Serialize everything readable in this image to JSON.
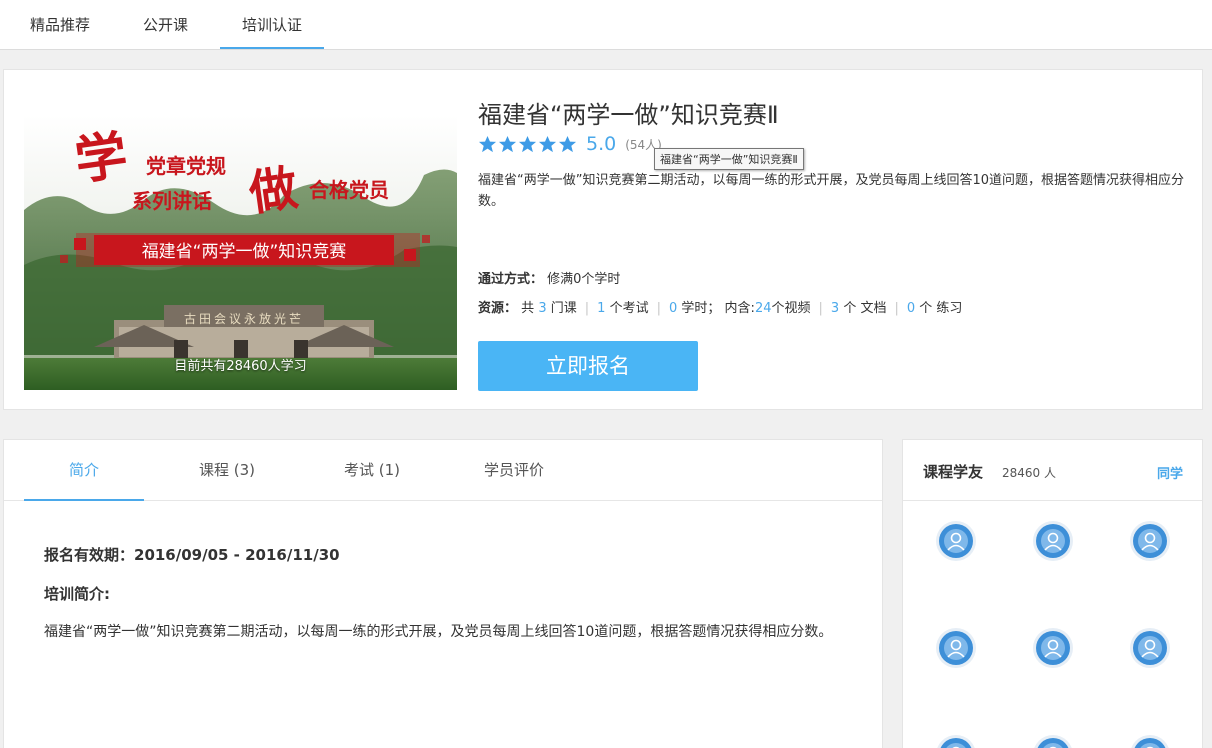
{
  "nav": {
    "tabs": [
      {
        "label": "精品推荐"
      },
      {
        "label": "公开课"
      },
      {
        "label": "培训认证"
      }
    ],
    "active_index": 2
  },
  "course": {
    "title": "福建省“两学一做”知识竞赛Ⅱ",
    "rating": 5.0,
    "score_text": "5.0",
    "rating_count": "(54人)",
    "tooltip": "福建省“两学一做”知识竞赛Ⅱ",
    "description": "福建省“两学一做”知识竞赛第二期活动，以每周一练的形式开展，及党员每周上线回答10道问题，根据答题情况获得相应分数。",
    "pass_label": "通过方式：",
    "pass_value": "修满0个学时",
    "resources": {
      "label": "资源：",
      "total_prefix": "共",
      "courses": "3",
      "courses_unit": "门课",
      "exams": "1",
      "exams_unit": "个考试",
      "hours": "0",
      "hours_unit": "学时；",
      "contains_label": "内含:",
      "videos": "24",
      "videos_unit": "个视频",
      "docs": "3",
      "docs_unit": "个 文档",
      "practice": "0",
      "practice_unit": "个 练习"
    },
    "enroll_label": "立即报名",
    "cover": {
      "line_party_rules": "党章党规",
      "line_series": "系列讲话",
      "big_char_study": "学",
      "big_char_do": "做",
      "line_qualified": "合格党员",
      "banner": "福建省“两学一做”知识竞赛",
      "sign": "古田会议永放光芒",
      "learners": "目前共有28460人学习"
    }
  },
  "detail": {
    "tabs": [
      {
        "label": "简介"
      },
      {
        "label": "课程 (3)"
      },
      {
        "label": "考试 (1)"
      },
      {
        "label": "学员评价"
      }
    ],
    "active_index": 0,
    "validity": "报名有效期：2016/09/05 - 2016/11/30",
    "intro_heading": "培训简介:",
    "intro_text": "福建省“两学一做”知识竞赛第二期活动，以每周一练的形式开展，及党员每周上线回答10道问题，根据答题情况获得相应分数。"
  },
  "classmates": {
    "title": "课程学友",
    "count": "28460 人",
    "link": "同学",
    "avatar_icon": "default-user-avatar-icon"
  },
  "colors": {
    "accent": "#4aa8ea",
    "button": "#4ab5f5",
    "star": "#3e9be6"
  }
}
